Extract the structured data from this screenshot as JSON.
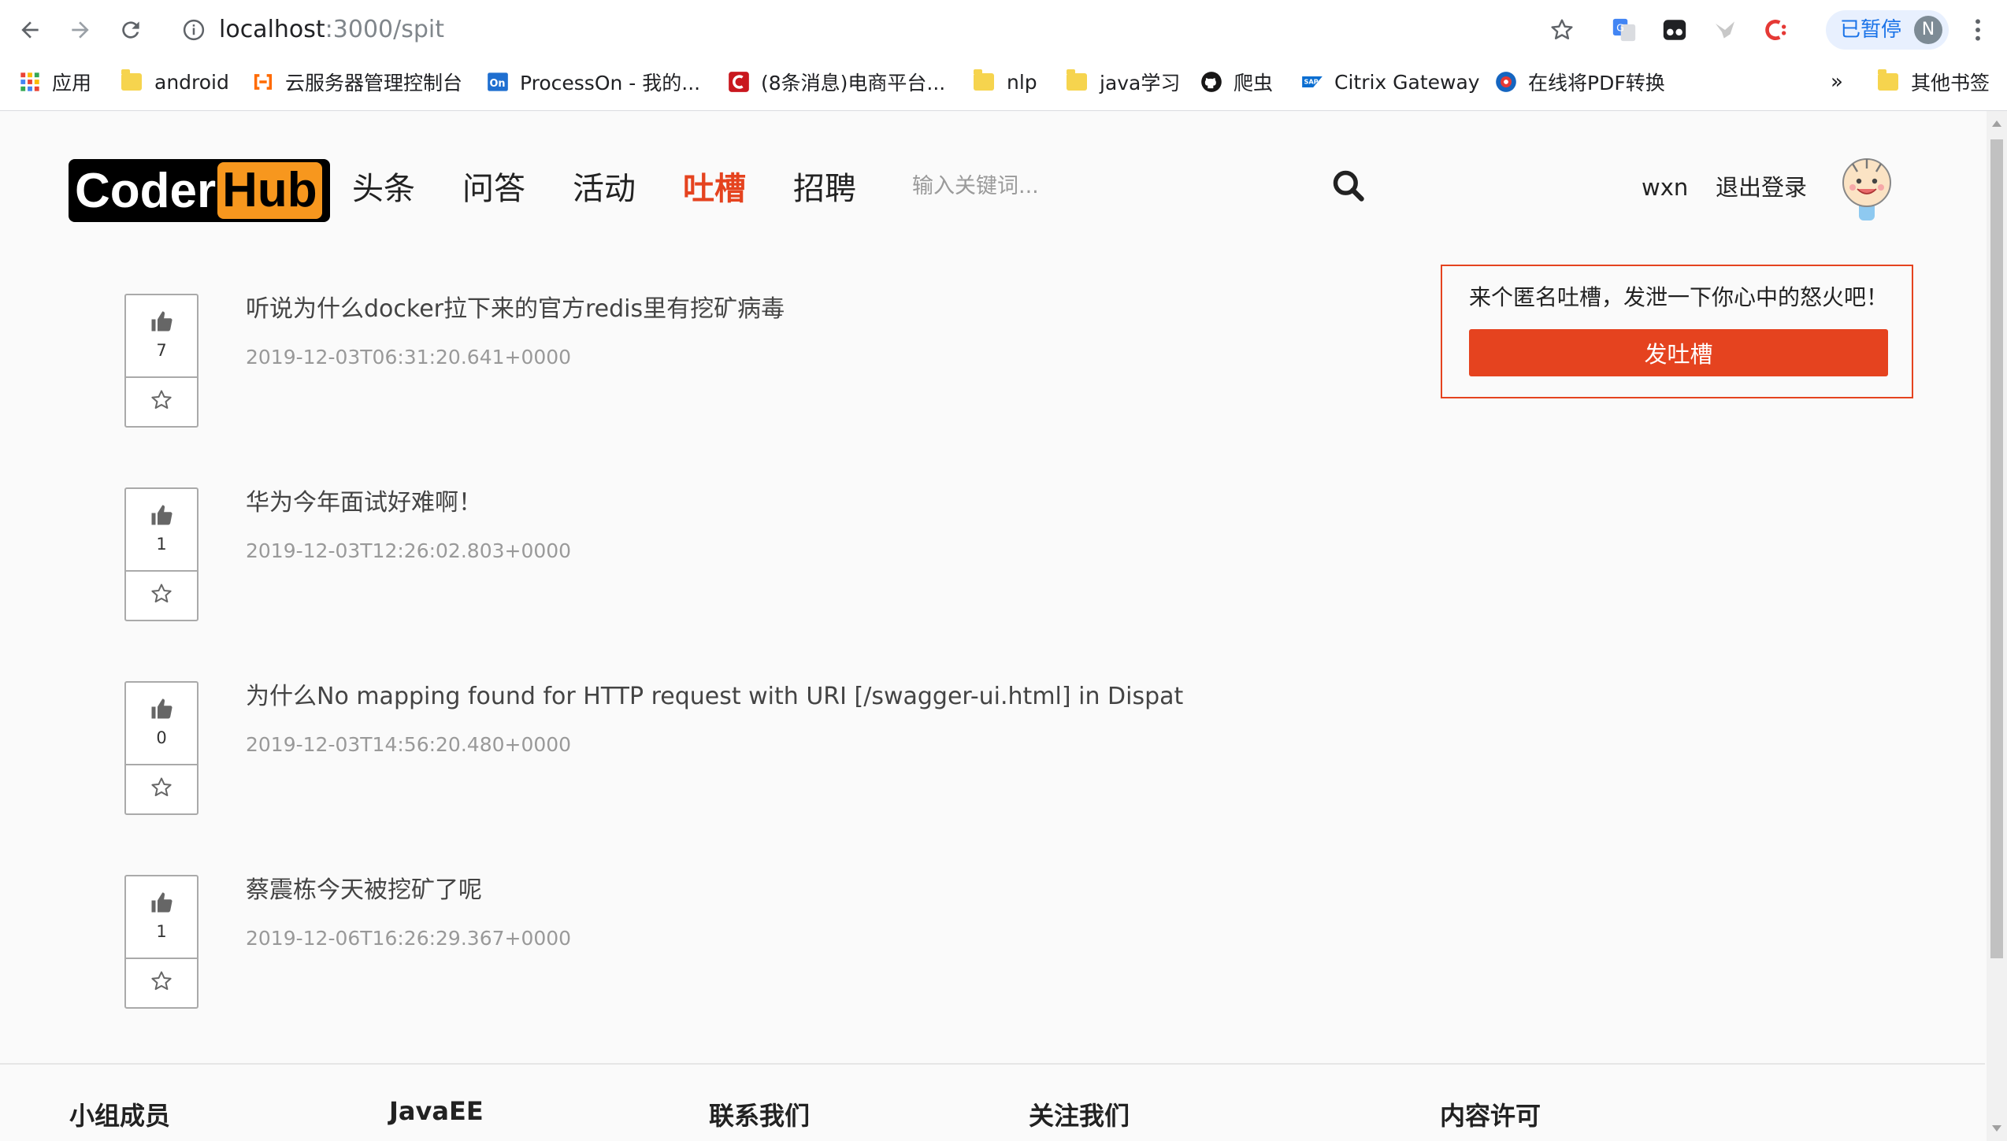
{
  "browser": {
    "url_host": "localhost",
    "url_path": ":3000/spit",
    "paused_label": "已暂停",
    "profile_initial": "N",
    "bookmarks": [
      {
        "label": "应用",
        "icon": "apps-grid-icon"
      },
      {
        "label": "android",
        "icon": "folder-icon"
      },
      {
        "label": "云服务器管理控制台",
        "icon": "aliyun-icon"
      },
      {
        "label": "ProcessOn - 我的...",
        "icon": "processon-icon"
      },
      {
        "label": "(8条消息)电商平台...",
        "icon": "csdn-icon"
      },
      {
        "label": "nlp",
        "icon": "folder-icon"
      },
      {
        "label": "java学习",
        "icon": "folder-icon"
      },
      {
        "label": "爬虫",
        "icon": "github-icon"
      },
      {
        "label": "Citrix Gateway",
        "icon": "sap-icon"
      },
      {
        "label": "在线将PDF转换",
        "icon": "pdf-convert-icon"
      }
    ],
    "more_bookmarks": "»",
    "other_bookmarks": "其他书签"
  },
  "header": {
    "logo_left": "Coder",
    "logo_right": "Hub",
    "nav": [
      {
        "label": "头条",
        "active": false
      },
      {
        "label": "问答",
        "active": false
      },
      {
        "label": "活动",
        "active": false
      },
      {
        "label": "吐槽",
        "active": true
      },
      {
        "label": "招聘",
        "active": false
      }
    ],
    "search_placeholder": "输入关键词...",
    "username": "wxn",
    "logout": "退出登录"
  },
  "spits": [
    {
      "title": "听说为什么docker拉下来的官方redis里有挖矿病毒",
      "time": "2019-12-03T06:31:20.641+0000",
      "likes": "7"
    },
    {
      "title": "华为今年面试好难啊！",
      "time": "2019-12-03T12:26:02.803+0000",
      "likes": "1"
    },
    {
      "title": "为什么No mapping found for HTTP request with URI [/swagger-ui.html] in Dispat",
      "time": "2019-12-03T14:56:20.480+0000",
      "likes": "0"
    },
    {
      "title": "蔡震栋今天被挖矿了呢",
      "time": "2019-12-06T16:26:29.367+0000",
      "likes": "1"
    }
  ],
  "sidebar": {
    "prompt": "来个匿名吐槽，发泄一下你心中的怒火吧！",
    "button": "发吐槽"
  },
  "footer": {
    "columns": [
      "小组成员",
      "JavaEE",
      "联系我们",
      "关注我们",
      "内容许可"
    ]
  },
  "colors": {
    "accent": "#e5431f",
    "logo_orange": "#f7971e"
  }
}
